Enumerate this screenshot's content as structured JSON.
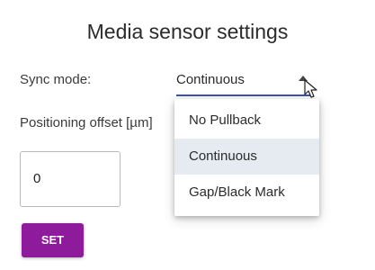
{
  "title": "Media sensor settings",
  "sync_mode": {
    "label": "Sync mode:",
    "value": "Continuous",
    "options": [
      "No Pullback",
      "Continuous",
      "Gap/Black Mark"
    ]
  },
  "offset": {
    "label": "Positioning offset [µm]",
    "value": "0"
  },
  "set_button": {
    "label": "SET"
  },
  "colors": {
    "accent": "#3f51b5",
    "button": "#8e1a9c",
    "menu_selected": "#e6ebf2"
  }
}
